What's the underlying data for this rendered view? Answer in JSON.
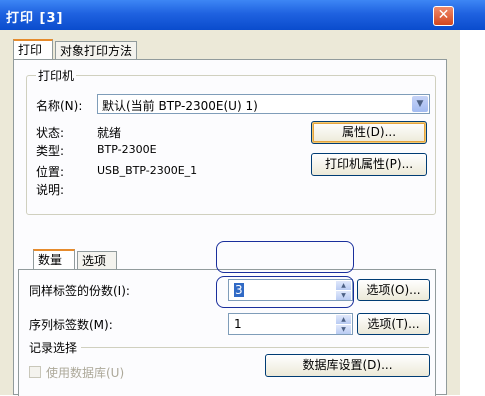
{
  "window": {
    "title": "打印 [3]",
    "close_symbol": "✕"
  },
  "tabs": [
    {
      "label": "打印"
    },
    {
      "label": "对象打印方法"
    }
  ],
  "printer_group": {
    "label": "打印机",
    "name_label": "名称(N):",
    "name_value": "默认(当前 BTP-2300E(U) 1)",
    "status_label": "状态:",
    "status_value": "就绪",
    "type_label": "类型:",
    "type_value": "BTP-2300E",
    "location_label": "位置:",
    "location_value": "USB_BTP-2300E_1",
    "comment_label": "说明:",
    "properties_button": "属性(D)...",
    "printer_properties_button": "打印机属性(P)..."
  },
  "sub_tabs": [
    {
      "label": "数量"
    },
    {
      "label": "选项"
    }
  ],
  "quantity": {
    "copies_label": "同样标签的份数(I):",
    "copies_value": "3",
    "copies_options_button": "选项(O)...",
    "serial_label": "序列标签数(M):",
    "serial_value": "1",
    "serial_options_button": "选项(T)..."
  },
  "records": {
    "label": "记录选择",
    "use_database_label": "使用数据库(U)",
    "database_settings_button": "数据库设置(D)..."
  }
}
